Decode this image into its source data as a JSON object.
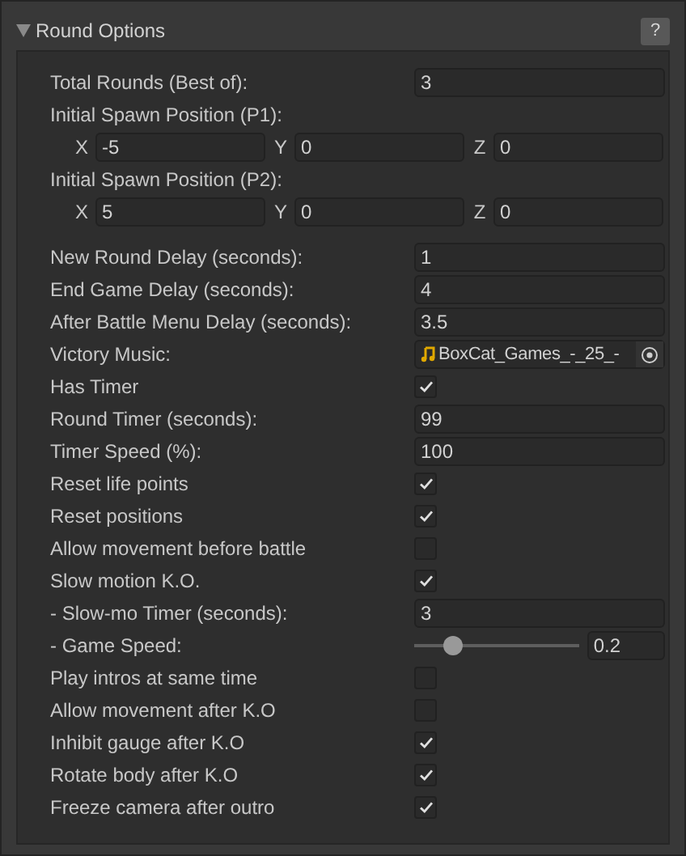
{
  "section": {
    "title": "Round Options",
    "expanded": true,
    "help": "?"
  },
  "groups": [
    {
      "rows": [
        {
          "kind": "number",
          "label": "Total Rounds (Best of):",
          "value": "3"
        },
        {
          "kind": "vector",
          "label": "Initial Spawn Position (P1):",
          "components": [
            {
              "axis": "X",
              "value": "-5"
            },
            {
              "axis": "Y",
              "value": "0"
            },
            {
              "axis": "Z",
              "value": "0"
            }
          ]
        },
        {
          "kind": "vector",
          "label": "Initial Spawn Position (P2):",
          "components": [
            {
              "axis": "X",
              "value": "5"
            },
            {
              "axis": "Y",
              "value": "0"
            },
            {
              "axis": "Z",
              "value": "0"
            }
          ]
        }
      ]
    },
    {
      "rows": [
        {
          "kind": "number",
          "label": "New Round Delay (seconds):",
          "value": "1"
        },
        {
          "kind": "number",
          "label": "End Game Delay (seconds):",
          "value": "4"
        },
        {
          "kind": "number",
          "label": "After Battle Menu Delay (seconds):",
          "value": "3.5"
        },
        {
          "kind": "object",
          "label": "Victory Music:",
          "value": "BoxCat_Games_-_25_-"
        },
        {
          "kind": "checkbox",
          "label": "Has Timer",
          "checked": true
        },
        {
          "kind": "number",
          "label": "Round Timer (seconds):",
          "value": "99"
        },
        {
          "kind": "number",
          "label": "Timer Speed (%):",
          "value": "100"
        },
        {
          "kind": "checkbox",
          "label": "Reset life points",
          "checked": true
        },
        {
          "kind": "checkbox",
          "label": "Reset positions",
          "checked": true
        },
        {
          "kind": "checkbox",
          "label": "Allow movement before battle",
          "checked": false
        },
        {
          "kind": "checkbox",
          "label": "Slow motion K.O.",
          "checked": true
        },
        {
          "kind": "number",
          "label": "- Slow-mo Timer (seconds):",
          "value": "3"
        },
        {
          "kind": "slider",
          "label": "- Game Speed:",
          "level": 0.2,
          "value": "0.2"
        },
        {
          "kind": "checkbox",
          "label": "Play intros at same time",
          "checked": false
        },
        {
          "kind": "checkbox",
          "label": "Allow movement after K.O",
          "checked": false
        },
        {
          "kind": "checkbox",
          "label": "Inhibit gauge after K.O",
          "checked": true
        },
        {
          "kind": "checkbox",
          "label": "Rotate body after K.O",
          "checked": true
        },
        {
          "kind": "checkbox",
          "label": "Freeze camera after outro",
          "checked": true
        }
      ]
    }
  ]
}
